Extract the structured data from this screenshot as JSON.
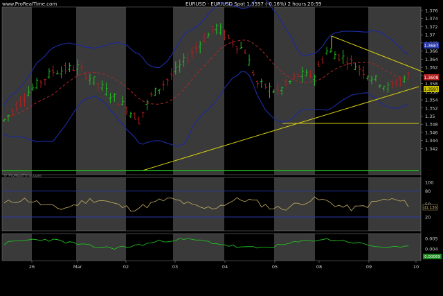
{
  "header": {
    "brand": "www.ProRealTime.com",
    "title": "EURUSD - EUR/USD Spot   1.3597 (-0.16%)   2 hours  20:59"
  },
  "watermark": "© ProRealTime.com",
  "price_axis": {
    "ticks": [
      "1.376",
      "1.374",
      "1.372",
      "1.37",
      "1.368",
      "1.366",
      "1.364",
      "1.362",
      "1.36",
      "1.358",
      "1.356",
      "1.354",
      "1.352",
      "1.35",
      "1.348",
      "1.346",
      "1.344",
      "1.342"
    ],
    "badges": [
      {
        "text": "1.3687",
        "color": "#2a3aa8"
      },
      {
        "text": "1.3608",
        "color": "#b02020"
      },
      {
        "text": "1.3597",
        "color": "#c8c000"
      }
    ]
  },
  "oscillator": {
    "ticks": [
      "100",
      "80",
      "50",
      "20"
    ],
    "badge": "d1.136"
  },
  "volume_axis": {
    "ticks": [
      "0.005",
      "0.004"
    ],
    "badge": "0.00069"
  },
  "date_axis": {
    "labels": [
      "26",
      "Mar",
      "02",
      "03",
      "04",
      "05",
      "08",
      "09",
      "10"
    ]
  },
  "colors": {
    "band_gray": "#3a3a3a",
    "band_black": "#000000",
    "bollinger": "#1c2a9a",
    "ma_dashed": "#b02828",
    "trend_line": "#d8d010",
    "support": "#20c020",
    "candle_up": "#20c020",
    "candle_down": "#b02020",
    "osc_line": "#c8b060",
    "osc_level": "#2a3aa8",
    "vol_line": "#20c020"
  }
}
